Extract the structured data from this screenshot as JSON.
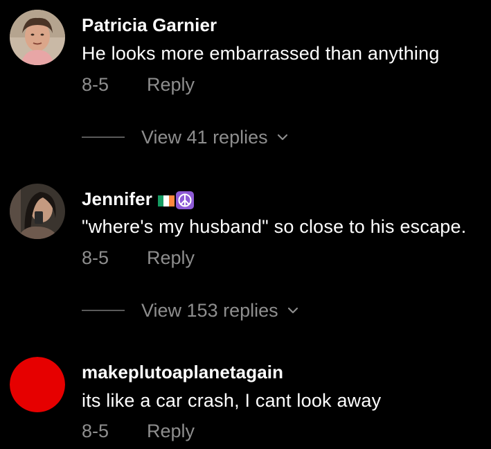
{
  "comments": [
    {
      "username": "Patricia Garnier",
      "text": "He looks more embarrassed than anything",
      "date": "8-5",
      "reply_label": "Reply",
      "view_replies": "View 41 replies",
      "avatar_icon": "user-photo-avatar"
    },
    {
      "username": "Jennifer",
      "username_emoji": [
        "ireland-flag-icon",
        "peace-symbol-icon"
      ],
      "text": "\"where's my husband\" so close to his escape.",
      "date": "8-5",
      "reply_label": "Reply",
      "view_replies": "View 153 replies",
      "avatar_icon": "user-photo-avatar"
    },
    {
      "username": "makeplutoaplanetagain",
      "text": "its like a car crash, I cant look away",
      "date": "8-5",
      "reply_label": "Reply",
      "avatar_icon": "red-circle-avatar"
    }
  ],
  "colors": {
    "background": "#000000",
    "text_primary": "#ffffff",
    "text_secondary": "#8e8e8e",
    "avatar_red": "#e60000"
  }
}
